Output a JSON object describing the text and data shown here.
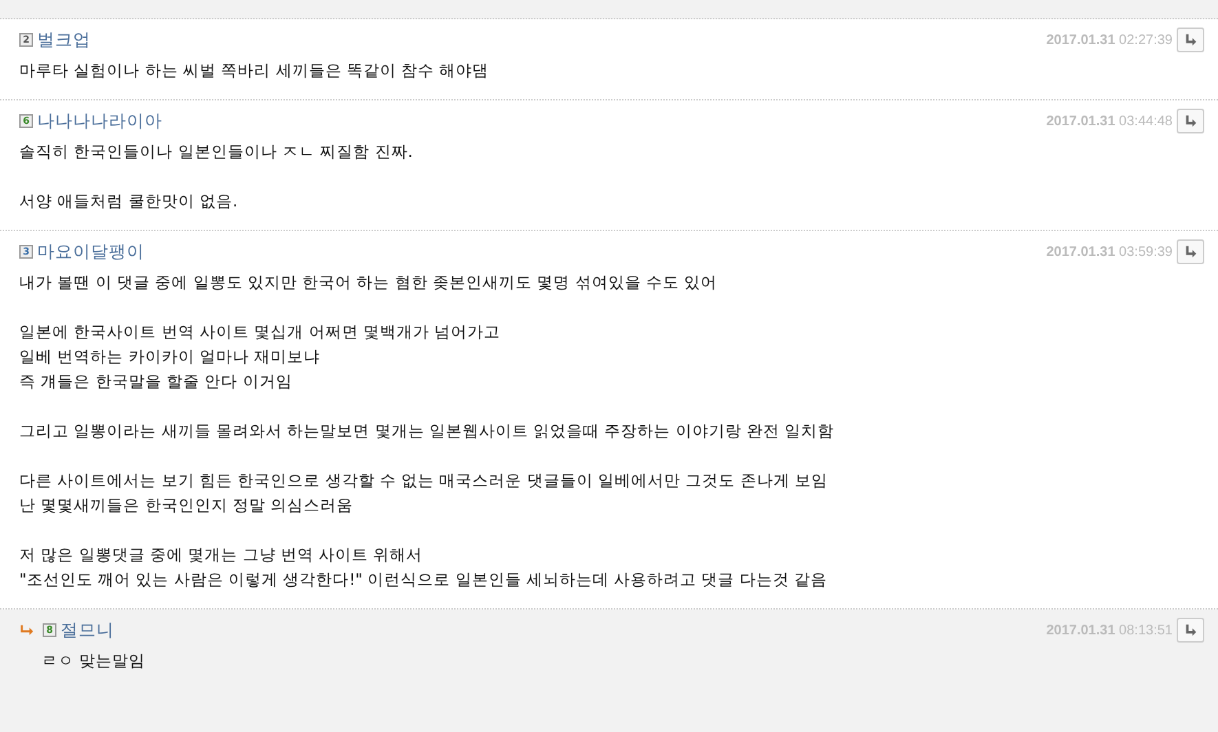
{
  "comments": [
    {
      "kind": "comment",
      "badge": "2",
      "color": "#555555",
      "author": "벌크업",
      "date": "2017.01.31",
      "time": "02:27:39",
      "paragraphs": [
        [
          "마루타 실험이나 하는 씨벌 쪽바리 세끼들은 똑같이 참수 해야댐"
        ]
      ]
    },
    {
      "kind": "comment",
      "badge": "6",
      "color": "#3a8a2a",
      "author": "나나나나라이아",
      "date": "2017.01.31",
      "time": "03:44:48",
      "paragraphs": [
        [
          "솔직히 한국인들이나 일본인들이나 ㅈㄴ 찌질함 진짜."
        ],
        [
          "서양 애들처럼 쿨한맛이 없음."
        ]
      ]
    },
    {
      "kind": "comment",
      "badge": "3",
      "color": "#3a6fa8",
      "author": "마요이달팽이",
      "date": "2017.01.31",
      "time": "03:59:39",
      "paragraphs": [
        [
          "내가 볼땐 이 댓글 중에 일뽕도 있지만 한국어 하는 혐한 좆본인새끼도 몇명 섞여있을 수도 있어"
        ],
        [
          "일본에 한국사이트 번역 사이트 몇십개 어쩌면 몇백개가 넘어가고",
          "일베 번역하는 카이카이 얼마나 재미보냐",
          "즉 걔들은 한국말을 할줄 안다 이거임"
        ],
        [
          "그리고 일뽕이라는 새끼들 몰려와서 하는말보면 몇개는 일본웹사이트 읽었을때 주장하는 이야기랑 완전 일치함"
        ],
        [
          "다른 사이트에서는 보기 힘든 한국인으로 생각할 수 없는 매국스러운 댓글들이 일베에서만 그것도 존나게 보임",
          "난 몇몇새끼들은 한국인인지 정말 의심스러움"
        ],
        [
          "저 많은 일뽕댓글 중에 몇개는 그냥 번역 사이트 위해서",
          "\"조선인도 깨어 있는 사람은 이렇게 생각한다!\" 이런식으로 일본인들 세뇌하는데 사용하려고 댓글 다는것 같음"
        ]
      ]
    },
    {
      "kind": "reply",
      "badge": "8",
      "color": "#3a8a2a",
      "author": "절므니",
      "date": "2017.01.31",
      "time": "08:13:51",
      "paragraphs": [
        [
          "ㄹㅇ 맞는말임"
        ]
      ]
    }
  ]
}
